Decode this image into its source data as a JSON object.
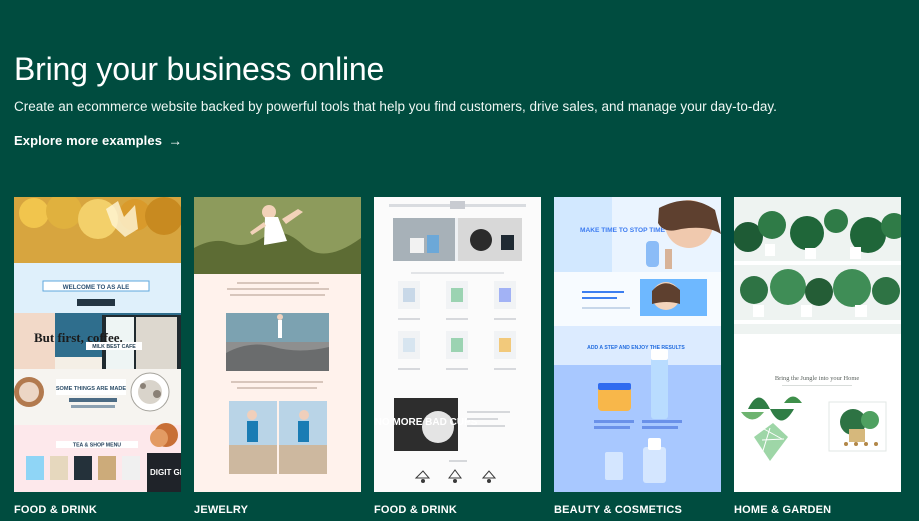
{
  "hero": {
    "title": "Bring your business online",
    "subtitle": "Create an ecommerce website backed by powerful tools that help you find customers, drive sales, and manage your day-to-day.",
    "link_label": "Explore more examples",
    "link_arrow": "→",
    "link_icon": "arrow-right-icon"
  },
  "examples": [
    {
      "category": "FOOD & DRINK",
      "preview": {
        "banner_heading": "WELCOME TO AS ALE",
        "overlay_text": "But first, coffee.",
        "name_banner": "MILK BEST CAFE",
        "menu_heading": "SOME THINGS ARE MADE",
        "bottom_heading": "TEA & SHOP MENU",
        "corner_text": "DIGIT GIFTC"
      }
    },
    {
      "category": "JEWELRY"
    },
    {
      "category": "FOOD & DRINK",
      "preview": {
        "sticker_text": "NO MORE BAD CUPS"
      }
    },
    {
      "category": "BEAUTY & COSMETICS",
      "preview": {
        "headline": "MAKE TIME TO STOP TIME",
        "subhead": "ADD A STEP AND ENJOY THE RESULTS"
      }
    },
    {
      "category": "HOME & GARDEN",
      "preview": {
        "tagline": "Bring the Jungle into your Home"
      }
    }
  ],
  "colors": {
    "background": "#004c3f",
    "text": "#ffffff",
    "jewelry_bg": "#fff2ec",
    "beauty_blue": "#a8c8ff",
    "garden_bg": "#ffffff"
  }
}
